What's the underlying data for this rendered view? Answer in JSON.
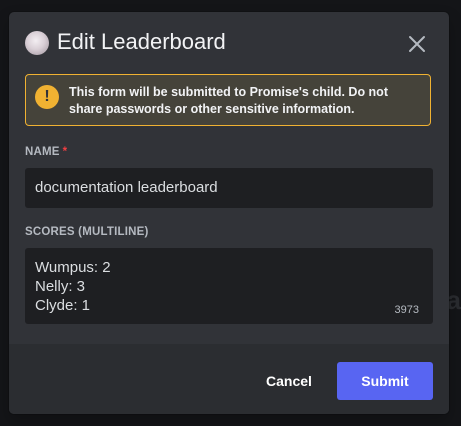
{
  "modal": {
    "title": "Edit Leaderboard"
  },
  "warning": {
    "prefix": "This form will be submitted to ",
    "app_name": "Promise's child",
    "suffix": ". Do not share passwords or other sensitive information.",
    "icon": "exclamation-icon",
    "accent_color": "#f0b232"
  },
  "fields": {
    "name": {
      "label": "NAME",
      "required_marker": "*",
      "value": "documentation leaderboard"
    },
    "scores": {
      "label": "SCORES (MULTILINE)",
      "lines": [
        "Wumpus: 2",
        "Nelly: 3",
        "Clyde: 1"
      ],
      "remaining_chars": "3973"
    }
  },
  "footer": {
    "cancel_label": "Cancel",
    "submit_label": "Submit",
    "submit_color": "#5865f2"
  }
}
